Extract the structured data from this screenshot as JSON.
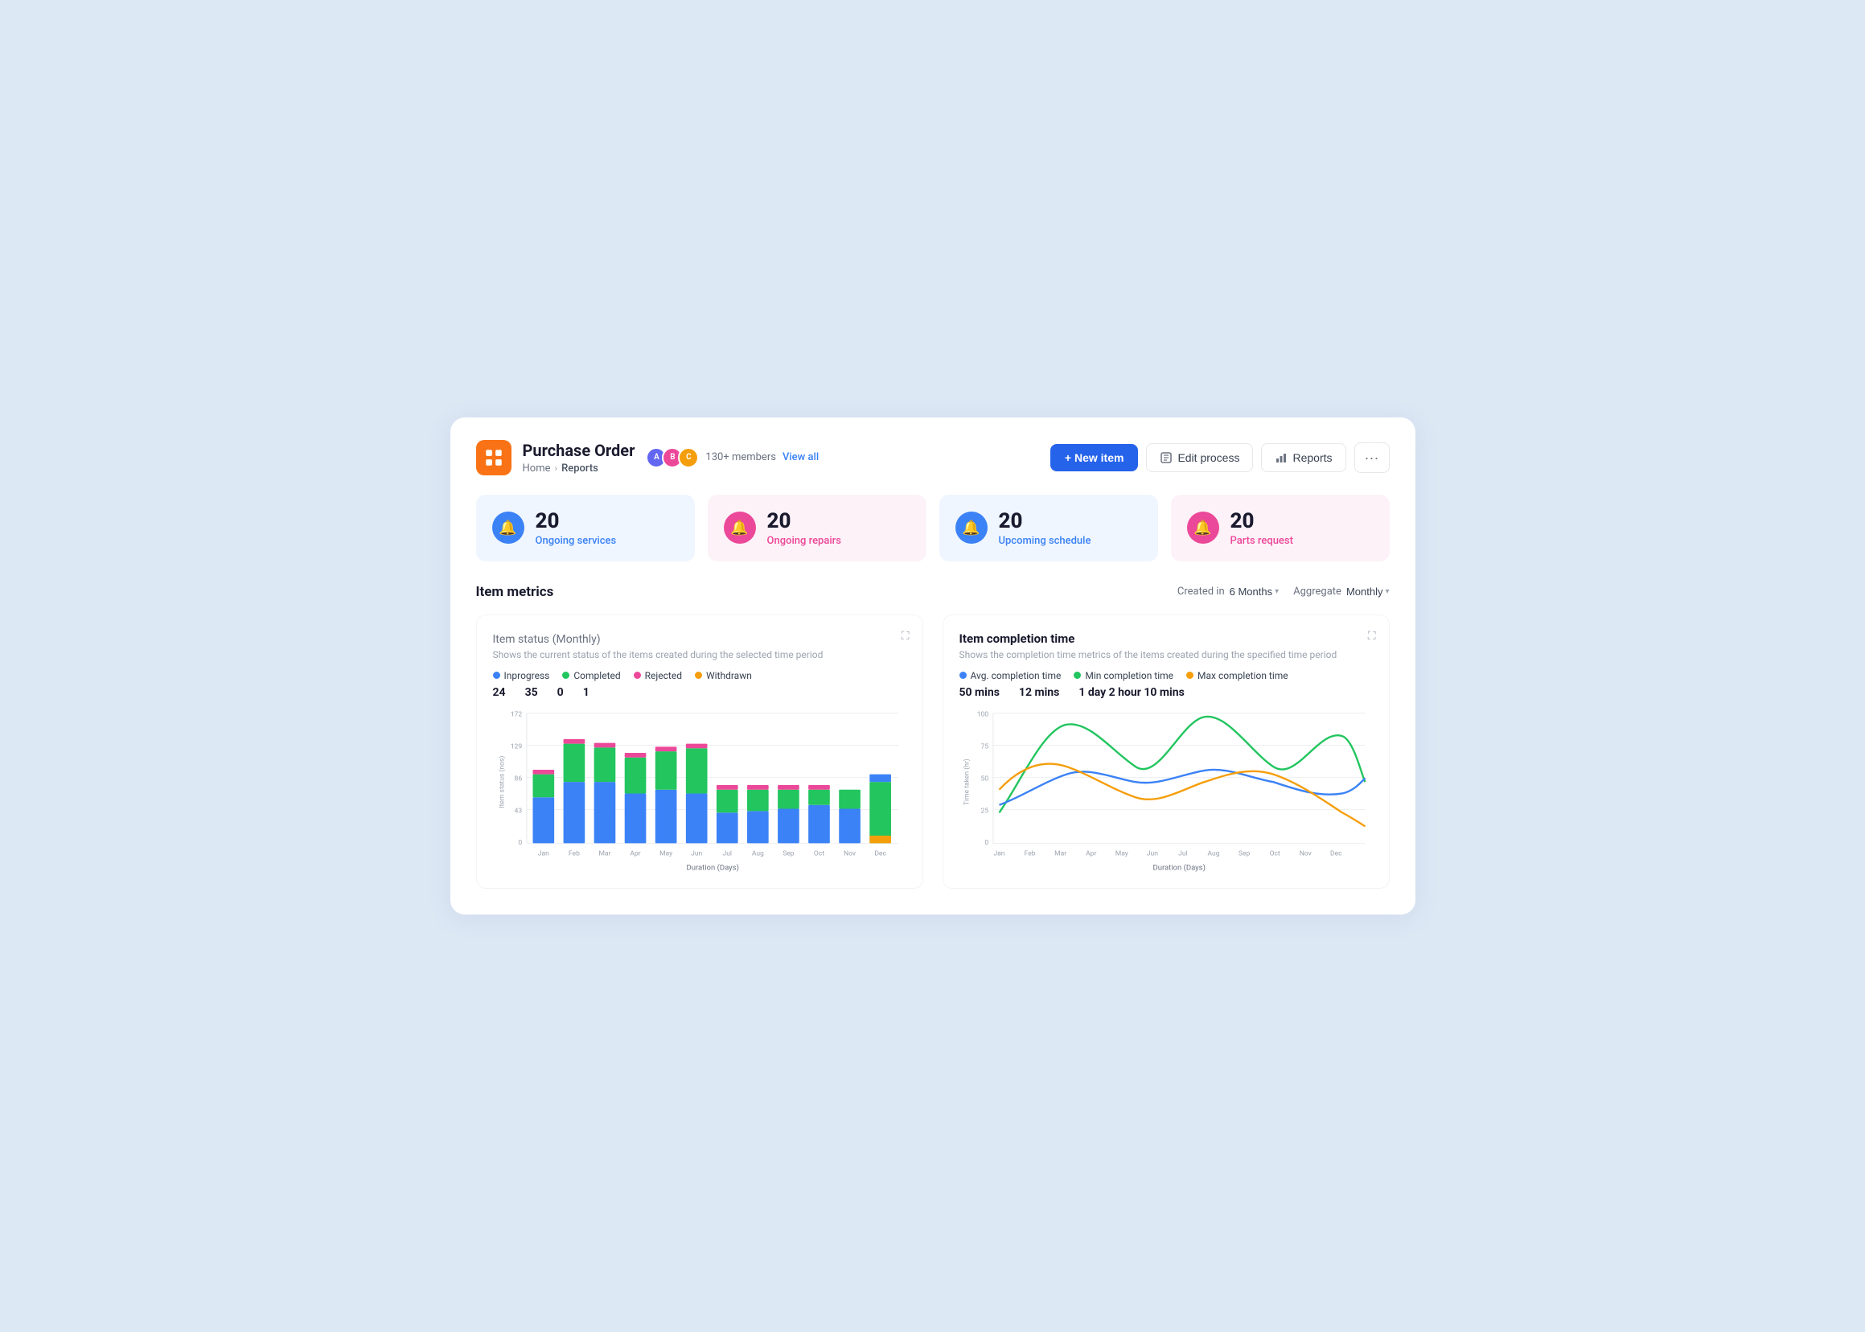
{
  "app": {
    "icon": "grid-icon",
    "title": "Purchase Order",
    "breadcrumb": {
      "home": "Home",
      "separator": ">",
      "current": "Reports"
    },
    "members": {
      "count_label": "130+ members",
      "view_all": "View all"
    }
  },
  "header_buttons": {
    "new_item": "+ New item",
    "edit_process": "Edit process",
    "reports": "Reports",
    "more": "···"
  },
  "stats": [
    {
      "number": "20",
      "label": "Ongoing services",
      "color": "blue"
    },
    {
      "number": "20",
      "label": "Ongoing repairs",
      "color": "pink"
    },
    {
      "number": "20",
      "label": "Upcoming schedule",
      "color": "blue"
    },
    {
      "number": "20",
      "label": "Parts request",
      "color": "pink"
    }
  ],
  "metrics": {
    "title": "Item metrics",
    "created_in_label": "Created in",
    "created_in_value": "6 Months",
    "aggregate_label": "Aggregate",
    "aggregate_value": "Monthly"
  },
  "item_status_chart": {
    "title": "Item status",
    "subtitle_period": "(Monthly)",
    "description": "Shows the current status of the items created during the selected time period",
    "legend": [
      {
        "label": "Inprogress",
        "color": "#3b82f6",
        "value": "24"
      },
      {
        "label": "Completed",
        "color": "#22c55e",
        "value": "35"
      },
      {
        "label": "Rejected",
        "color": "#ec4899",
        "value": "0"
      },
      {
        "label": "Withdrawn",
        "color": "#f59e0b",
        "value": "1"
      }
    ],
    "y_axis_label": "Item status (nos)",
    "x_axis_label": "Duration (Days)",
    "y_ticks": [
      "172",
      "129",
      "86",
      "43",
      "0"
    ],
    "x_ticks": [
      "Jan",
      "Feb",
      "Mar",
      "Apr",
      "May",
      "Jun",
      "Jul",
      "Aug",
      "Sep",
      "Oct",
      "Nov",
      "Dec"
    ]
  },
  "completion_time_chart": {
    "title": "Item completion time",
    "description": "Shows the completion time metrics of the items created during the specified time period",
    "legend": [
      {
        "label": "Avg. completion time",
        "color": "#3b82f6",
        "value": "50 mins"
      },
      {
        "label": "Min completion time",
        "color": "#22c55e",
        "value": "12 mins"
      },
      {
        "label": "Max completion time",
        "color": "#f59e0b",
        "value": "1 day 2 hour 10 mins"
      }
    ],
    "y_axis_label": "Time taken (hr)",
    "x_axis_label": "Duration (Days)",
    "y_ticks": [
      "100",
      "75",
      "50",
      "25",
      "0"
    ],
    "x_ticks": [
      "Jan",
      "Feb",
      "Mar",
      "Apr",
      "May",
      "Jun",
      "Jul",
      "Aug",
      "Sep",
      "Oct",
      "Nov",
      "Dec"
    ]
  }
}
